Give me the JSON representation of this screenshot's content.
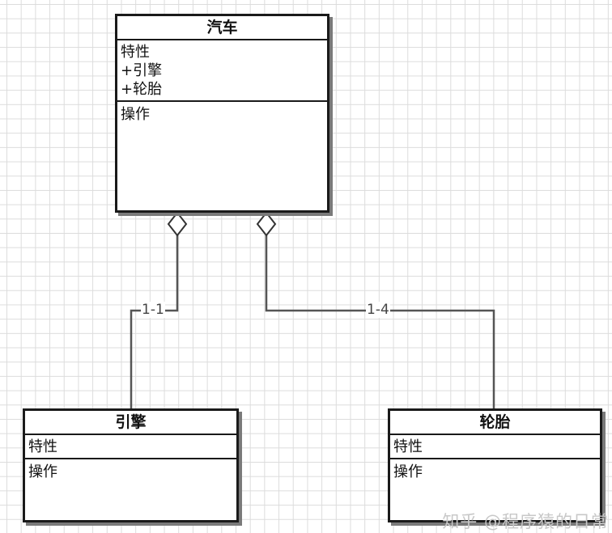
{
  "classes": {
    "car": {
      "name": "汽车",
      "attr_header": "特性",
      "attributes": [
        "+引擎",
        "+轮胎"
      ],
      "ops_header": "操作"
    },
    "engine": {
      "name": "引擎",
      "attr_header": "特性",
      "ops_header": "操作"
    },
    "tire": {
      "name": "轮胎",
      "attr_header": "特性",
      "ops_header": "操作"
    }
  },
  "connections": {
    "car_engine": {
      "multiplicity": "1-1",
      "kind": "aggregation"
    },
    "car_tire": {
      "multiplicity": "1-4",
      "kind": "aggregation"
    }
  },
  "watermark": "知乎 @程序猿的日常",
  "colors": {
    "line": "#555555",
    "border": "#1a1a1a",
    "grid": "#dcdcdc"
  }
}
